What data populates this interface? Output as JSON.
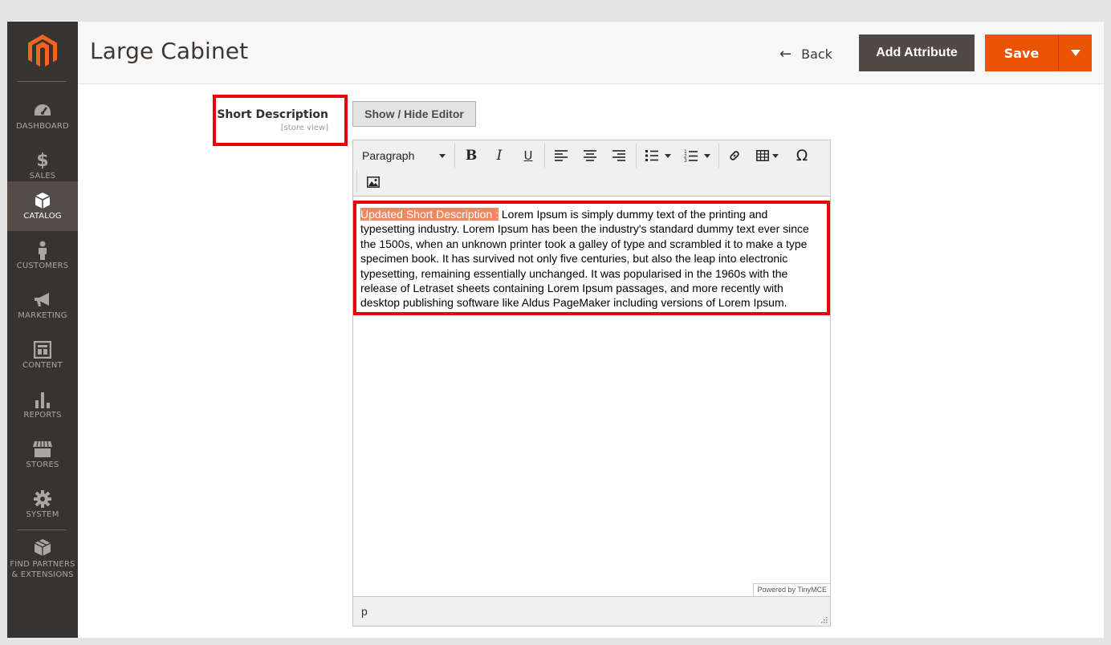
{
  "sidebar": {
    "logo": "magento-logo",
    "items": [
      {
        "label": "DASHBOARD",
        "icon": "dashboard-icon"
      },
      {
        "label": "SALES",
        "icon": "dollar-icon"
      },
      {
        "label": "CATALOG",
        "icon": "box-icon",
        "active": true
      },
      {
        "label": "CUSTOMERS",
        "icon": "person-icon"
      },
      {
        "label": "MARKETING",
        "icon": "megaphone-icon"
      },
      {
        "label": "CONTENT",
        "icon": "layout-icon"
      },
      {
        "label": "REPORTS",
        "icon": "bar-chart-icon"
      },
      {
        "label": "STORES",
        "icon": "store-icon"
      },
      {
        "label": "SYSTEM",
        "icon": "gear-icon"
      },
      {
        "label": "FIND PARTNERS & EXTENSIONS",
        "icon": "boxes-icon"
      }
    ]
  },
  "header": {
    "title": "Large Cabinet",
    "back_label": "Back",
    "add_attribute_label": "Add Attribute",
    "save_label": "Save"
  },
  "field": {
    "label": "Short Description",
    "scope": "[store view]",
    "show_hide_label": "Show / Hide Editor"
  },
  "editor": {
    "block_format": "Paragraph",
    "highlighted_text": "Updated Short Description :",
    "body_text": " Lorem Ipsum is simply dummy text of the printing and typesetting industry. Lorem Ipsum has been the industry's standard dummy text ever since the 1500s, when an unknown printer took a galley of type and scrambled it to make a type specimen book. It has survived not only five centuries, but also the leap into electronic typesetting, remaining essentially unchanged. It was popularised in the 1960s with the release of Letraset sheets containing Lorem Ipsum passages, and more recently with desktop publishing software like Aldus PageMaker including versions of Lorem Ipsum.",
    "powered_by": "Powered by TinyMCE",
    "element_path": "p"
  },
  "colors": {
    "sidebar_bg": "#373330",
    "accent": "#eb5202",
    "highlight_box": "#e8000b",
    "selection": "#ee8860"
  }
}
